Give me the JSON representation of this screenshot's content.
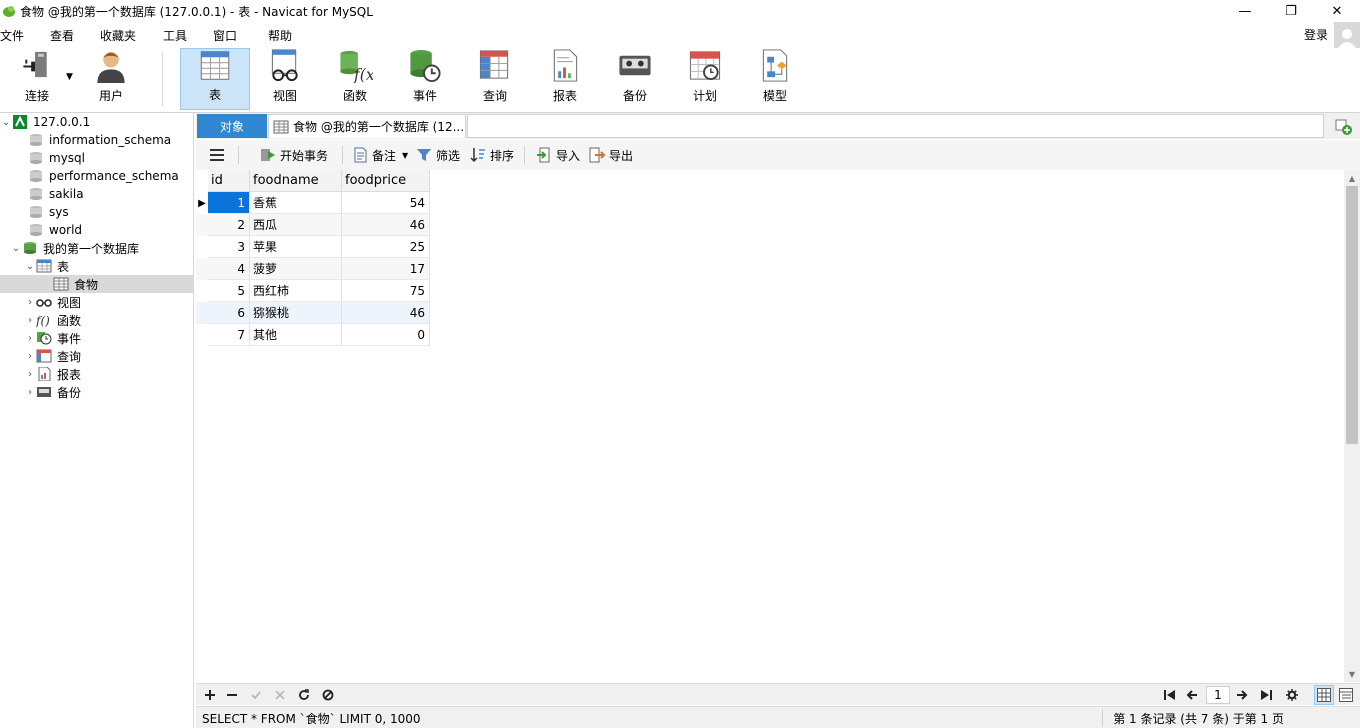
{
  "window": {
    "title": "食物 @我的第一个数据库 (127.0.0.1) - 表 - Navicat for MySQL",
    "minimize": "—",
    "maximize": "❐",
    "close": "✕"
  },
  "menu": [
    "文件",
    "查看",
    "收藏夹",
    "工具",
    "窗口",
    "帮助"
  ],
  "login_label": "登录",
  "toolbar": [
    {
      "label": "连接",
      "icon": "connection-icon"
    },
    {
      "label": "用户",
      "icon": "user-icon"
    },
    {
      "label": "表",
      "icon": "table-icon",
      "active": true
    },
    {
      "label": "视图",
      "icon": "view-icon"
    },
    {
      "label": "函数",
      "icon": "function-icon"
    },
    {
      "label": "事件",
      "icon": "event-icon"
    },
    {
      "label": "查询",
      "icon": "query-icon"
    },
    {
      "label": "报表",
      "icon": "report-icon"
    },
    {
      "label": "备份",
      "icon": "backup-icon"
    },
    {
      "label": "计划",
      "icon": "schedule-icon"
    },
    {
      "label": "模型",
      "icon": "model-icon"
    }
  ],
  "tree": {
    "connection": "127.0.0.1",
    "databases": [
      "information_schema",
      "mysql",
      "performance_schema",
      "sakila",
      "sys",
      "world"
    ],
    "open_db": "我的第一个数据库",
    "tables_label": "表",
    "selected_table": "食物",
    "nodes": [
      "视图",
      "函数",
      "事件",
      "查询",
      "报表",
      "备份"
    ]
  },
  "tabs": {
    "objects": "对象",
    "table_tab": "食物 @我的第一个数据库 (12..."
  },
  "subtoolbar": {
    "begin_transaction": "开始事务",
    "memo": "备注",
    "filter": "筛选",
    "sort": "排序",
    "import": "导入",
    "export": "导出"
  },
  "grid": {
    "columns": [
      "id",
      "foodname",
      "foodprice"
    ],
    "rows": [
      {
        "id": "1",
        "foodname": "香蕉",
        "foodprice": "54"
      },
      {
        "id": "2",
        "foodname": "西瓜",
        "foodprice": "46"
      },
      {
        "id": "3",
        "foodname": "苹果",
        "foodprice": "25"
      },
      {
        "id": "4",
        "foodname": "菠萝",
        "foodprice": "17"
      },
      {
        "id": "5",
        "foodname": "西红柿",
        "foodprice": "75"
      },
      {
        "id": "6",
        "foodname": "猕猴桃",
        "foodprice": "46"
      },
      {
        "id": "7",
        "foodname": "其他",
        "foodprice": "0"
      }
    ]
  },
  "bottom": {
    "page": "1"
  },
  "status": {
    "sql": "SELECT * FROM `食物` LIMIT 0, 1000",
    "records": "第 1 条记录 (共 7 条) 于第 1 页"
  }
}
